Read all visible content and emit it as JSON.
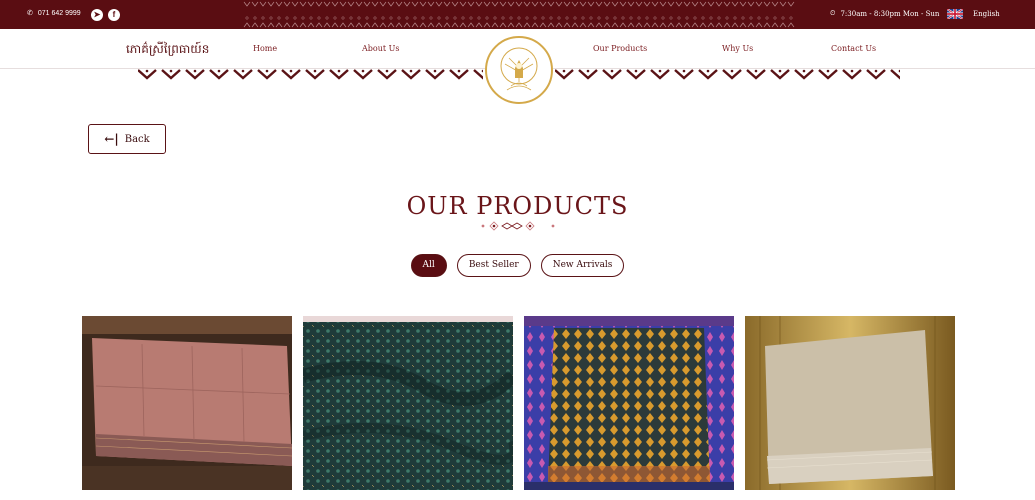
{
  "topbar": {
    "phone": "071 642 9999",
    "hours": "7:30am - 8:30pm Mon - Sun",
    "language": "English",
    "icons": [
      "phone-icon",
      "telegram-icon",
      "facebook-icon",
      "clock-icon",
      "uk-flag-icon"
    ]
  },
  "nav": {
    "brand": "ភោគ៌ស្រីព្រៃធាយ៍ន",
    "links": [
      "Home",
      "About Us",
      "Our Products",
      "Why Us",
      "Contact Us"
    ]
  },
  "back": {
    "label": "Back"
  },
  "page": {
    "title": "OUR PRODUCTS"
  },
  "filters": {
    "items": [
      "All",
      "Best Seller",
      "New Arrivals"
    ],
    "active": "All"
  },
  "colors": {
    "brand_maroon": "#5a0d12",
    "gold": "#d4a94a"
  },
  "products": [
    {
      "image": "pink silk scarf"
    },
    {
      "image": "dark teal patterned silk"
    },
    {
      "image": "blue and gold patterned silk"
    },
    {
      "image": "beige silk scarf"
    }
  ]
}
